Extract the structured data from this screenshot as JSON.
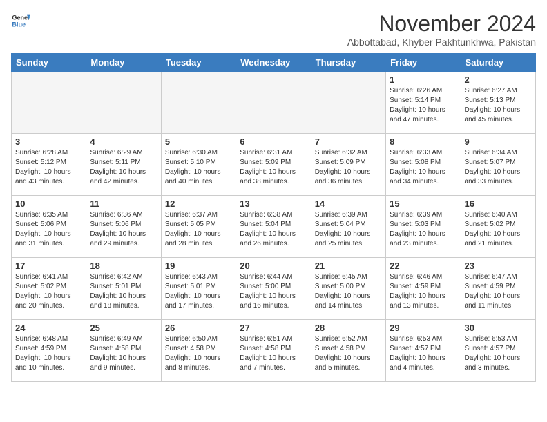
{
  "header": {
    "logo_line1": "General",
    "logo_line2": "Blue",
    "month_title": "November 2024",
    "subtitle": "Abbottabad, Khyber Pakhtunkhwa, Pakistan"
  },
  "days_of_week": [
    "Sunday",
    "Monday",
    "Tuesday",
    "Wednesday",
    "Thursday",
    "Friday",
    "Saturday"
  ],
  "weeks": [
    [
      {
        "day": "",
        "info": ""
      },
      {
        "day": "",
        "info": ""
      },
      {
        "day": "",
        "info": ""
      },
      {
        "day": "",
        "info": ""
      },
      {
        "day": "",
        "info": ""
      },
      {
        "day": "1",
        "info": "Sunrise: 6:26 AM\nSunset: 5:14 PM\nDaylight: 10 hours\nand 47 minutes."
      },
      {
        "day": "2",
        "info": "Sunrise: 6:27 AM\nSunset: 5:13 PM\nDaylight: 10 hours\nand 45 minutes."
      }
    ],
    [
      {
        "day": "3",
        "info": "Sunrise: 6:28 AM\nSunset: 5:12 PM\nDaylight: 10 hours\nand 43 minutes."
      },
      {
        "day": "4",
        "info": "Sunrise: 6:29 AM\nSunset: 5:11 PM\nDaylight: 10 hours\nand 42 minutes."
      },
      {
        "day": "5",
        "info": "Sunrise: 6:30 AM\nSunset: 5:10 PM\nDaylight: 10 hours\nand 40 minutes."
      },
      {
        "day": "6",
        "info": "Sunrise: 6:31 AM\nSunset: 5:09 PM\nDaylight: 10 hours\nand 38 minutes."
      },
      {
        "day": "7",
        "info": "Sunrise: 6:32 AM\nSunset: 5:09 PM\nDaylight: 10 hours\nand 36 minutes."
      },
      {
        "day": "8",
        "info": "Sunrise: 6:33 AM\nSunset: 5:08 PM\nDaylight: 10 hours\nand 34 minutes."
      },
      {
        "day": "9",
        "info": "Sunrise: 6:34 AM\nSunset: 5:07 PM\nDaylight: 10 hours\nand 33 minutes."
      }
    ],
    [
      {
        "day": "10",
        "info": "Sunrise: 6:35 AM\nSunset: 5:06 PM\nDaylight: 10 hours\nand 31 minutes."
      },
      {
        "day": "11",
        "info": "Sunrise: 6:36 AM\nSunset: 5:06 PM\nDaylight: 10 hours\nand 29 minutes."
      },
      {
        "day": "12",
        "info": "Sunrise: 6:37 AM\nSunset: 5:05 PM\nDaylight: 10 hours\nand 28 minutes."
      },
      {
        "day": "13",
        "info": "Sunrise: 6:38 AM\nSunset: 5:04 PM\nDaylight: 10 hours\nand 26 minutes."
      },
      {
        "day": "14",
        "info": "Sunrise: 6:39 AM\nSunset: 5:04 PM\nDaylight: 10 hours\nand 25 minutes."
      },
      {
        "day": "15",
        "info": "Sunrise: 6:39 AM\nSunset: 5:03 PM\nDaylight: 10 hours\nand 23 minutes."
      },
      {
        "day": "16",
        "info": "Sunrise: 6:40 AM\nSunset: 5:02 PM\nDaylight: 10 hours\nand 21 minutes."
      }
    ],
    [
      {
        "day": "17",
        "info": "Sunrise: 6:41 AM\nSunset: 5:02 PM\nDaylight: 10 hours\nand 20 minutes."
      },
      {
        "day": "18",
        "info": "Sunrise: 6:42 AM\nSunset: 5:01 PM\nDaylight: 10 hours\nand 18 minutes."
      },
      {
        "day": "19",
        "info": "Sunrise: 6:43 AM\nSunset: 5:01 PM\nDaylight: 10 hours\nand 17 minutes."
      },
      {
        "day": "20",
        "info": "Sunrise: 6:44 AM\nSunset: 5:00 PM\nDaylight: 10 hours\nand 16 minutes."
      },
      {
        "day": "21",
        "info": "Sunrise: 6:45 AM\nSunset: 5:00 PM\nDaylight: 10 hours\nand 14 minutes."
      },
      {
        "day": "22",
        "info": "Sunrise: 6:46 AM\nSunset: 4:59 PM\nDaylight: 10 hours\nand 13 minutes."
      },
      {
        "day": "23",
        "info": "Sunrise: 6:47 AM\nSunset: 4:59 PM\nDaylight: 10 hours\nand 11 minutes."
      }
    ],
    [
      {
        "day": "24",
        "info": "Sunrise: 6:48 AM\nSunset: 4:59 PM\nDaylight: 10 hours\nand 10 minutes."
      },
      {
        "day": "25",
        "info": "Sunrise: 6:49 AM\nSunset: 4:58 PM\nDaylight: 10 hours\nand 9 minutes."
      },
      {
        "day": "26",
        "info": "Sunrise: 6:50 AM\nSunset: 4:58 PM\nDaylight: 10 hours\nand 8 minutes."
      },
      {
        "day": "27",
        "info": "Sunrise: 6:51 AM\nSunset: 4:58 PM\nDaylight: 10 hours\nand 7 minutes."
      },
      {
        "day": "28",
        "info": "Sunrise: 6:52 AM\nSunset: 4:58 PM\nDaylight: 10 hours\nand 5 minutes."
      },
      {
        "day": "29",
        "info": "Sunrise: 6:53 AM\nSunset: 4:57 PM\nDaylight: 10 hours\nand 4 minutes."
      },
      {
        "day": "30",
        "info": "Sunrise: 6:53 AM\nSunset: 4:57 PM\nDaylight: 10 hours\nand 3 minutes."
      }
    ]
  ]
}
